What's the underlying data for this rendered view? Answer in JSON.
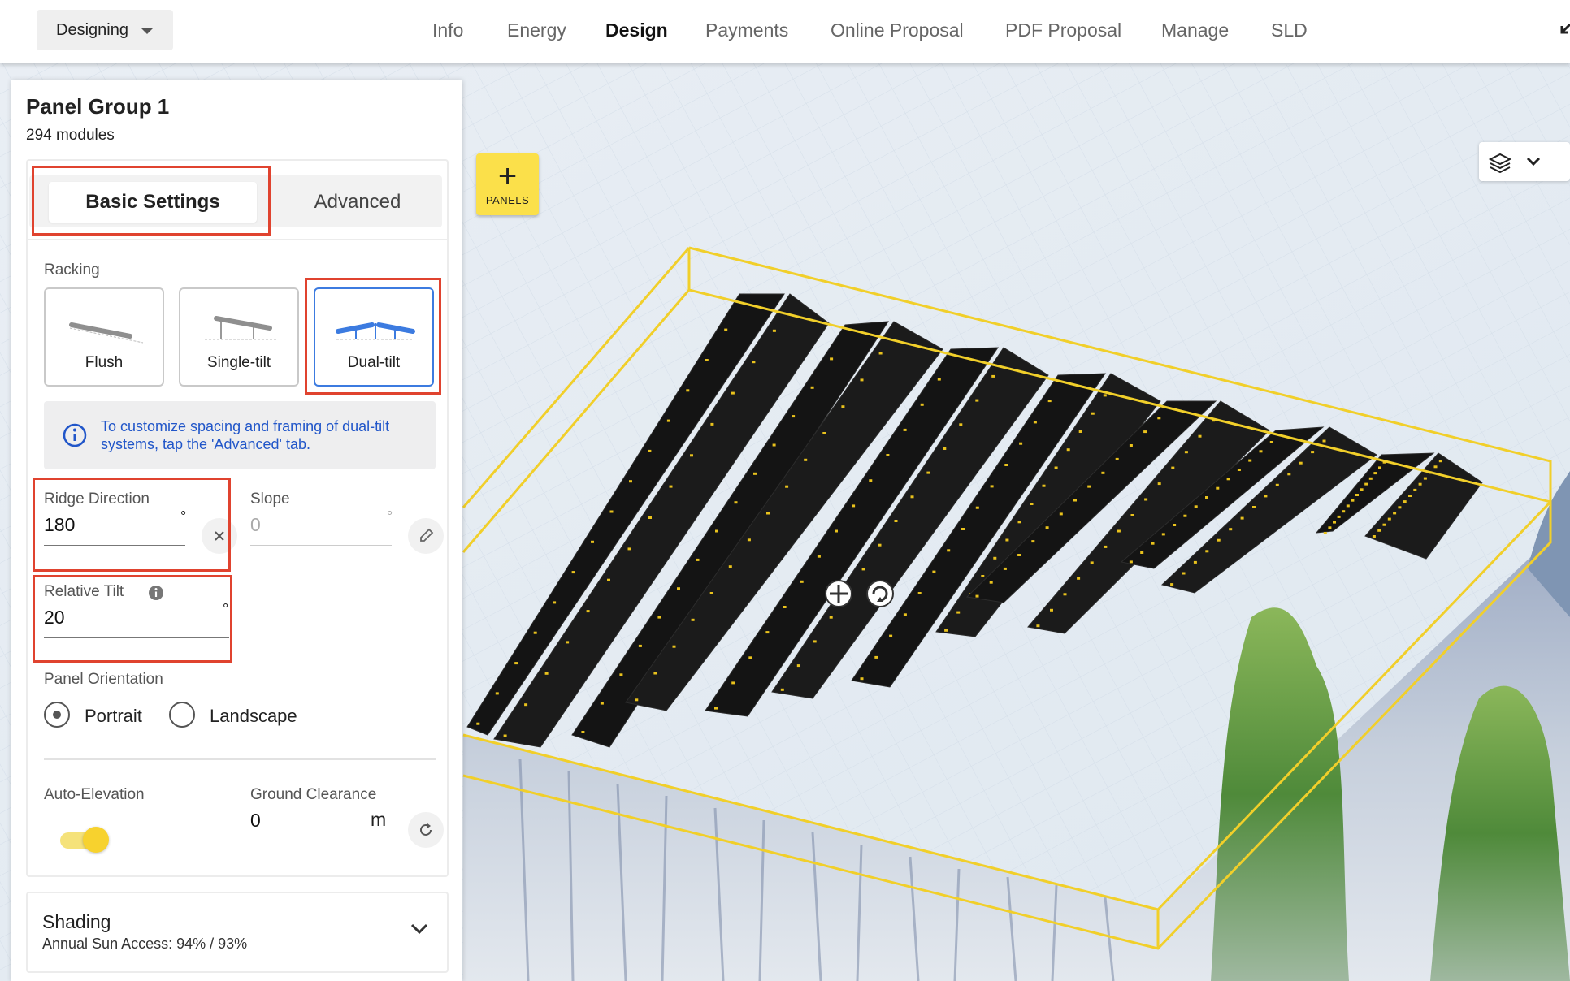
{
  "topbar": {
    "mode": "Designing",
    "nav": [
      "Info",
      "Energy",
      "Design",
      "Payments",
      "Online Proposal",
      "PDF Proposal",
      "Manage",
      "SLD"
    ],
    "active_nav": "Design"
  },
  "viewport": {
    "add_panels_label": "PANELS",
    "add_panels_icon": "plus-icon",
    "layers_icon": "layers-icon"
  },
  "panel": {
    "title": "Panel Group 1",
    "subtitle": "294 modules",
    "tabs": [
      "Basic Settings",
      "Advanced"
    ],
    "racking_label": "Racking",
    "racking_options": [
      "Flush",
      "Single-tilt",
      "Dual-tilt"
    ],
    "racking_selected": "Dual-tilt",
    "info_text": "To customize spacing and framing of dual-tilt systems, tap the 'Advanced' tab.",
    "ridge_direction": {
      "label": "Ridge Direction",
      "value": "180",
      "unit": "°"
    },
    "slope": {
      "label": "Slope",
      "placeholder": "0",
      "unit": "°"
    },
    "relative_tilt": {
      "label": "Relative Tilt",
      "value": "20",
      "unit": "°"
    },
    "orientation_label": "Panel Orientation",
    "orientation_options": [
      "Portrait",
      "Landscape"
    ],
    "orientation_selected": "Portrait",
    "auto_elevation": {
      "label": "Auto-Elevation",
      "on": true
    },
    "ground_clearance": {
      "label": "Ground Clearance",
      "value": "0",
      "unit": "m"
    },
    "shading": {
      "title": "Shading",
      "subtitle": "Annual Sun Access: 94% / 93%"
    }
  },
  "colors": {
    "accent_yellow": "#fbe04a",
    "selection_blue": "#3c7be0",
    "annotation_red": "#e0432f",
    "info_text_blue": "#2156c9"
  }
}
